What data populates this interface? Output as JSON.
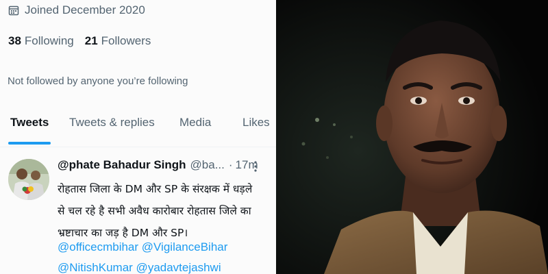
{
  "profile": {
    "joined": "Joined December 2020",
    "following_count": "38",
    "following_label": "Following",
    "followers_count": "21",
    "followers_label": "Followers",
    "not_followed": "Not followed by anyone you’re following"
  },
  "tabs": [
    {
      "label": "Tweets",
      "active": true
    },
    {
      "label": "Tweets & replies",
      "active": false
    },
    {
      "label": "Media",
      "active": false
    },
    {
      "label": "Likes",
      "active": false
    }
  ],
  "tweet": {
    "name": "@phate Bahadur Singh",
    "handle": "@ba...",
    "separator": "·",
    "time": "17m",
    "lines": [
      "रोहतास जिला के DM और SP के संरक्षक में धड़ले",
      "से चल रहे है सभी अवैध कारोबार रोहतास जिले का",
      "भ्रष्टाचार का जड़ है DM और SP।"
    ],
    "mentions": [
      "@officecmbihar @VigilanceBihar",
      "@NitishKumar @yadavtejashwi"
    ]
  },
  "colors": {
    "accent": "#1d9bf0",
    "muted_text": "#536471",
    "primary_text": "#0f1419"
  },
  "icons": {
    "calendar": "calendar-icon",
    "more": "more-vertical-icon"
  }
}
